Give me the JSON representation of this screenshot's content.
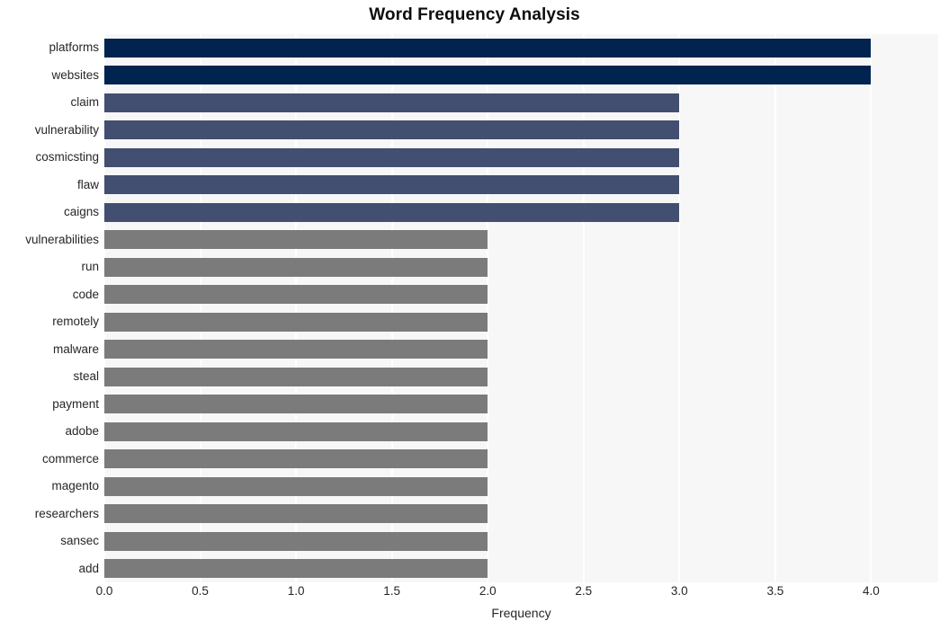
{
  "chart_data": {
    "type": "bar",
    "orientation": "horizontal",
    "title": "Word Frequency Analysis",
    "xlabel": "Frequency",
    "ylabel": "",
    "xlim": [
      0,
      4.35
    ],
    "xticks": [
      "0.0",
      "0.5",
      "1.0",
      "1.5",
      "2.0",
      "2.5",
      "3.0",
      "3.5",
      "4.0"
    ],
    "xtick_values": [
      0.0,
      0.5,
      1.0,
      1.5,
      2.0,
      2.5,
      3.0,
      3.5,
      4.0
    ],
    "grid": "vertical-white-on-gray",
    "legend": "none",
    "categories": [
      "platforms",
      "websites",
      "claim",
      "vulnerability",
      "cosmicsting",
      "flaw",
      "caigns",
      "vulnerabilities",
      "run",
      "code",
      "remotely",
      "malware",
      "steal",
      "payment",
      "adobe",
      "commerce",
      "magento",
      "researchers",
      "sansec",
      "add"
    ],
    "values": [
      4,
      4,
      3,
      3,
      3,
      3,
      3,
      2,
      2,
      2,
      2,
      2,
      2,
      2,
      2,
      2,
      2,
      2,
      2,
      2
    ],
    "bar_colors": [
      "#00234f",
      "#00234f",
      "#434f70",
      "#434f70",
      "#434f70",
      "#434f70",
      "#434f70",
      "#7b7b7b",
      "#7b7b7b",
      "#7b7b7b",
      "#7b7b7b",
      "#7b7b7b",
      "#7b7b7b",
      "#7b7b7b",
      "#7b7b7b",
      "#7b7b7b",
      "#7b7b7b",
      "#7b7b7b",
      "#7b7b7b",
      "#7b7b7b"
    ]
  },
  "style": {
    "plot_background": "#f7f7f7",
    "figure_background": "#ffffff",
    "gridline_color": "#ffffff",
    "text_color": "#262626",
    "title_color": "#0d0d0d"
  }
}
